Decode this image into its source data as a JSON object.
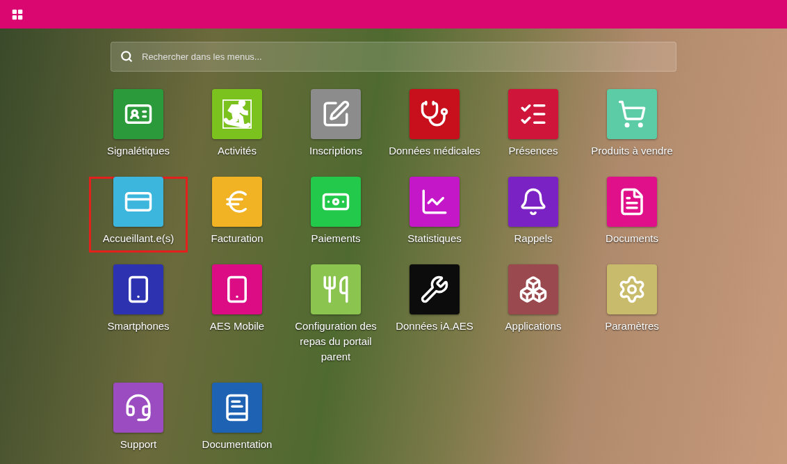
{
  "search": {
    "placeholder": "Rechercher dans les menus..."
  },
  "apps": [
    {
      "label": "Signalétiques",
      "color": "#2a9a3a",
      "highlighted": false
    },
    {
      "label": "Activités",
      "color": "#7cc21e",
      "highlighted": false
    },
    {
      "label": "Inscriptions",
      "color": "#8c8c8c",
      "highlighted": false
    },
    {
      "label": "Données médicales",
      "color": "#c8101c",
      "highlighted": false
    },
    {
      "label": "Présences",
      "color": "#d0153a",
      "highlighted": false
    },
    {
      "label": "Produits à vendre",
      "color": "#5ccca6",
      "highlighted": false
    },
    {
      "label": "Accueillant.e(s)",
      "color": "#3cb6dc",
      "highlighted": true
    },
    {
      "label": "Facturation",
      "color": "#f1b324",
      "highlighted": false
    },
    {
      "label": "Paiements",
      "color": "#22c94a",
      "highlighted": false
    },
    {
      "label": "Statistiques",
      "color": "#c417c8",
      "highlighted": false
    },
    {
      "label": "Rappels",
      "color": "#7a22c4",
      "highlighted": false
    },
    {
      "label": "Documents",
      "color": "#e0108a",
      "highlighted": false
    },
    {
      "label": "Smartphones",
      "color": "#2d32b0",
      "highlighted": false
    },
    {
      "label": "AES Mobile",
      "color": "#dc0c84",
      "highlighted": false
    },
    {
      "label": "Configuration des repas du portail parent",
      "color": "#8cc450",
      "highlighted": false
    },
    {
      "label": "Données iA.AES",
      "color": "#0c0c0c",
      "highlighted": false
    },
    {
      "label": "Applications",
      "color": "#9a4a4e",
      "highlighted": false
    },
    {
      "label": "Paramètres",
      "color": "#c8bc6c",
      "highlighted": false
    },
    {
      "label": "Support",
      "color": "#9a4cc0",
      "highlighted": false
    },
    {
      "label": "Documentation",
      "color": "#1e62b4",
      "highlighted": false
    }
  ]
}
